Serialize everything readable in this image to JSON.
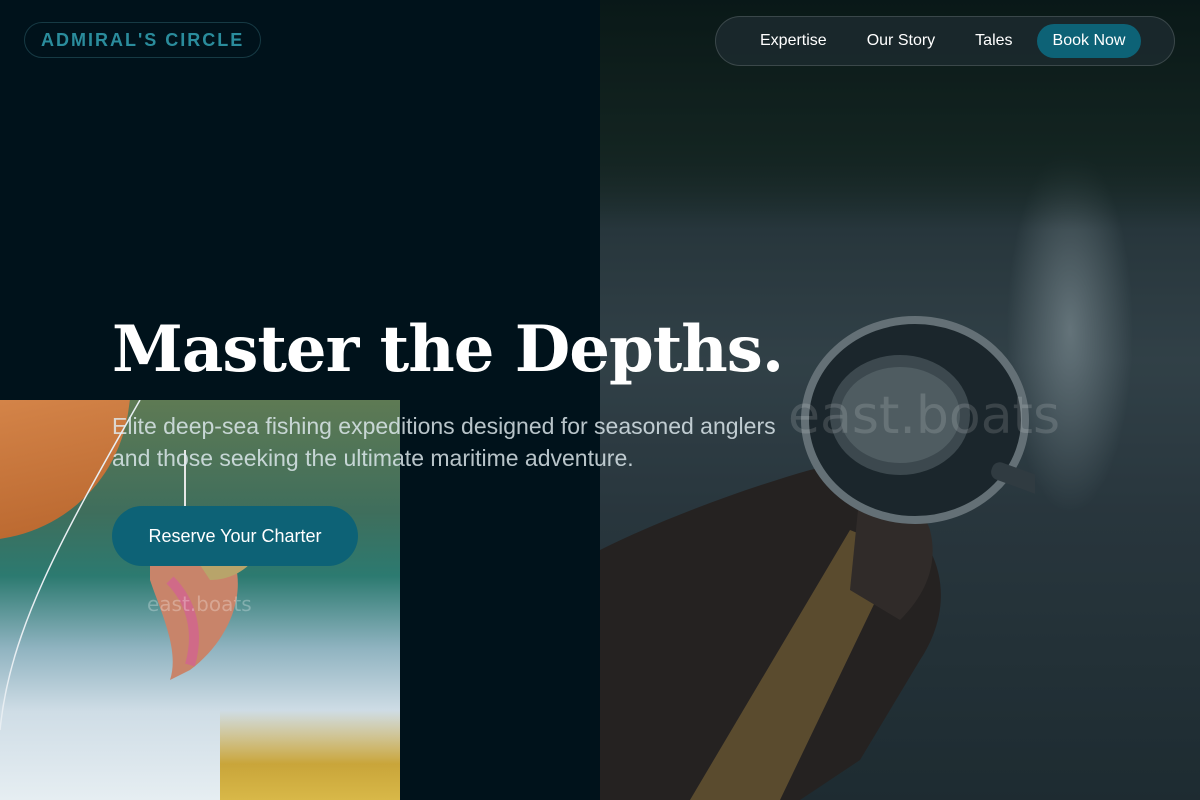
{
  "brand": {
    "name": "ADMIRAL'S CIRCLE"
  },
  "nav": {
    "items": [
      {
        "label": "Expertise"
      },
      {
        "label": "Our Story"
      },
      {
        "label": "Tales"
      }
    ],
    "cta_label": "Book Now"
  },
  "hero": {
    "title": "Master the Depths.",
    "subtitle": "Elite deep-sea fishing expeditions designed for seasoned anglers and those seeking the ultimate maritime adventure.",
    "cta_label": "Reserve Your Charter"
  },
  "watermarks": {
    "large": "east.boats",
    "small": "east.boats"
  },
  "colors": {
    "background": "#00121b",
    "accent": "#0d6276",
    "brand": "#2a8c9c"
  },
  "images": {
    "right": "angler-hand-holding-fishing-reel-over-lake",
    "left": "trout-on-fishing-line-over-water"
  }
}
